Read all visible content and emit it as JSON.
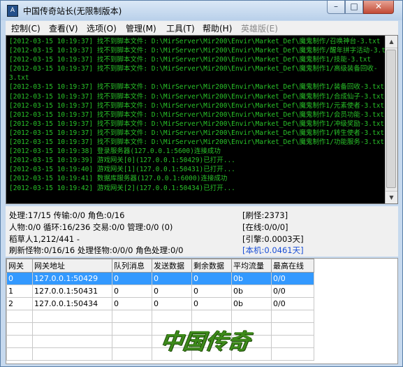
{
  "window": {
    "title": "中国传奇站长(无限制版本)",
    "app_icon": "A"
  },
  "menu": [
    {
      "label": "控制(C)",
      "enabled": true
    },
    {
      "label": "查看(V)",
      "enabled": true
    },
    {
      "label": "选项(O)",
      "enabled": true
    },
    {
      "label": "管理(M)",
      "enabled": true
    },
    {
      "label": "工具(T)",
      "enabled": true
    },
    {
      "label": "帮助(H)",
      "enabled": true
    },
    {
      "label": "英雄版(E)",
      "enabled": false
    }
  ],
  "log": [
    "[2012-03-15 10:19:37] 找不到脚本文件: D:\\MirServer\\Mir200\\Envir\\Market_Def\\魔鬼制作/召唤神台-3.txt",
    "[2012-03-15 10:19:37] 找不到脚本文件: D:\\MirServer\\Mir200\\Envir\\Market_Def\\魔鬼制作/醒年拼字活动-3.txt",
    "[2012-03-15 10:19:37] 找不到脚本文件: D:\\MirServer\\Mir200\\Envir\\Market_Def\\魔鬼制作1/技能-3.txt",
    "[2012-03-15 10:19:37] 找不到脚本文件: D:\\MirServer\\Mir200\\Envir\\Market_Def\\魔鬼制作1/高级装备回收-",
    "3.txt",
    "[2012-03-15 10:19:37] 找不到脚本文件: D:\\MirServer\\Mir200\\Envir\\Market_Def\\魔鬼制作1/装备回收-3.txt",
    "[2012-03-15 10:19:37] 找不到脚本文件: D:\\MirServer\\Mir200\\Envir\\Market_Def\\魔鬼制作1/合成仙子-3.txt",
    "[2012-03-15 10:19:37] 找不到脚本文件: D:\\MirServer\\Mir200\\Envir\\Market_Def\\魔鬼制作1/元素使者-3.txt",
    "[2012-03-15 10:19:37] 找不到脚本文件: D:\\MirServer\\Mir200\\Envir\\Market_Def\\魔鬼制作1/会员功能-3.txt",
    "[2012-03-15 10:19:37] 找不到脚本文件: D:\\MirServer\\Mir200\\Envir\\Market_Def\\魔鬼制作1/冲级奖励-3.txt",
    "[2012-03-15 10:19:37] 找不到脚本文件: D:\\MirServer\\Mir200\\Envir\\Market_Def\\魔鬼制作1/转生使者-3.txt",
    "[2012-03-15 10:19:37] 找不到脚本文件: D:\\MirServer\\Mir200\\Envir\\Market_Def\\魔鬼制作1/功能服务-3.txt",
    "[2012-03-15 10:19:38] 登录服务器(127.0.0.1:5600)连接成功",
    "[2012-03-15 10:19:39] 游戏网关[0](127.0.0.1:50429)已打开...",
    "[2012-03-15 10:19:40] 游戏网关[1](127.0.0.1:50431)已打开...",
    "[2012-03-15 10:19:41] 数据库服务器(127.0.0.1:6000)连接成功",
    "[2012-03-15 10:19:42] 游戏网关[2](127.0.0.1:50434)已打开..."
  ],
  "stats": {
    "line1": "处理:17/15 传输:0/0 角色:0/16",
    "line2": "人物:0/0 循环:16/236 交易:0/0 管理:0/0 (0)",
    "line3": "稻草人1,212/441 -",
    "line4": "刷新怪物:0/16/16 处理怪物:0/0/0 角色处理:0/0",
    "right1": "[刷怪:2373]",
    "right2": "[在线:0/0/0]",
    "right3": "[引擎:0.0003天]",
    "right4": "[本机:0.0461天]",
    "right4_color": "#1a4fd6"
  },
  "gateway_table": {
    "columns": [
      "网关",
      "网关地址",
      "队列消息",
      "发送数据",
      "剩余数据",
      "平均流量",
      "最高在线"
    ],
    "rows": [
      [
        "0",
        "127.0.0.1:50429",
        "0",
        "0",
        "0",
        "0b",
        "0/0"
      ],
      [
        "1",
        "127.0.0.1:50431",
        "0",
        "0",
        "0",
        "0b",
        "0/0"
      ],
      [
        "2",
        "127.0.0.1:50434",
        "0",
        "0",
        "0",
        "0b",
        "0/0"
      ]
    ],
    "selected_row": 0
  },
  "watermark": "中国传奇",
  "colors": {
    "log_text": "#29c229",
    "log_bg": "#000000",
    "selection": "#3399ff"
  }
}
